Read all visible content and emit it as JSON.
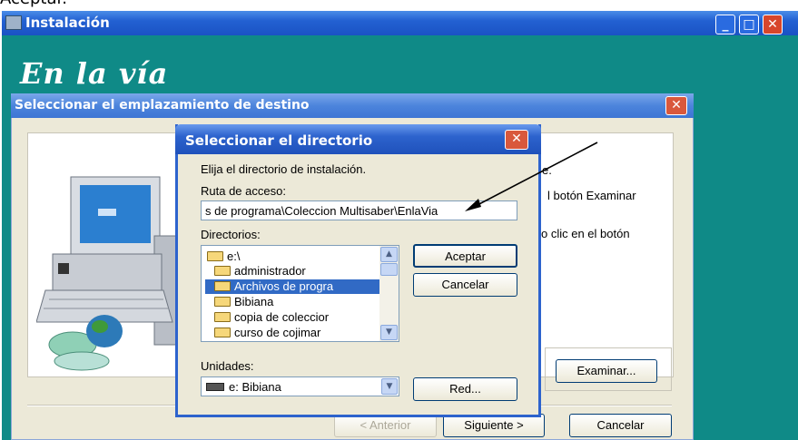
{
  "top_caption": "Aceptar.",
  "main_window": {
    "title": "Instalación",
    "brand": "En la vía",
    "controls": {
      "minimize": "_",
      "maximize": "□",
      "close": "✕"
    }
  },
  "dest_dialog": {
    "title": "Seleccionar el emplazamiento de destino",
    "close": "✕",
    "side_text_1": "e.",
    "side_text_2": "l botón Examinar",
    "side_text_3": "o clic en el botón",
    "browse_button": "Examinar...",
    "back_button": "< Anterior",
    "next_button": "Siguiente >",
    "cancel_button": "Cancelar"
  },
  "dir_dialog": {
    "title": "Seleccionar el directorio",
    "close": "✕",
    "instruction": "Elija el directorio de instalación.",
    "path_label": "Ruta de acceso:",
    "path_value": "s de programa\\Coleccion Multisaber\\EnlaVia",
    "dirs_label": "Directorios:",
    "directories": [
      {
        "name": "e:\\"
      },
      {
        "name": "administrador"
      },
      {
        "name": "Archivos de progra"
      },
      {
        "name": "Bibiana"
      },
      {
        "name": "copia de coleccior"
      },
      {
        "name": "curso de cojimar"
      }
    ],
    "selected_directory": "Archivos de progra",
    "drives_label": "Unidades:",
    "drive_value": "e: Bibiana",
    "accept_button": "Aceptar",
    "cancel_button": "Cancelar",
    "network_button": "Red..."
  }
}
